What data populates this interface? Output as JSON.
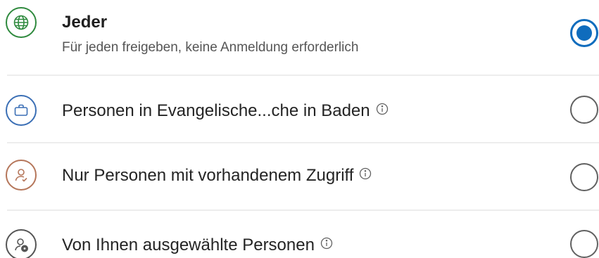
{
  "share_options": [
    {
      "title": "Jeder",
      "subtitle": "Für jeden freigeben, keine Anmeldung erforderlich",
      "icon": "globe-icon",
      "icon_color": "#2f8a3e",
      "selected": true
    },
    {
      "title": "Personen in Evangelische...che in Baden",
      "icon": "briefcase-icon",
      "icon_color": "#3b6fb5",
      "info": true,
      "selected": false
    },
    {
      "title": "Nur Personen mit vorhandenem Zugriff",
      "icon": "person-check-icon",
      "icon_color": "#b5765a",
      "info": true,
      "selected": false
    },
    {
      "title": "Von Ihnen ausgewählte Personen",
      "icon": "person-settings-icon",
      "icon_color": "#555555",
      "info": true,
      "selected": false
    }
  ],
  "colors": {
    "accent": "#0f6cbd",
    "divider": "#ededed"
  }
}
